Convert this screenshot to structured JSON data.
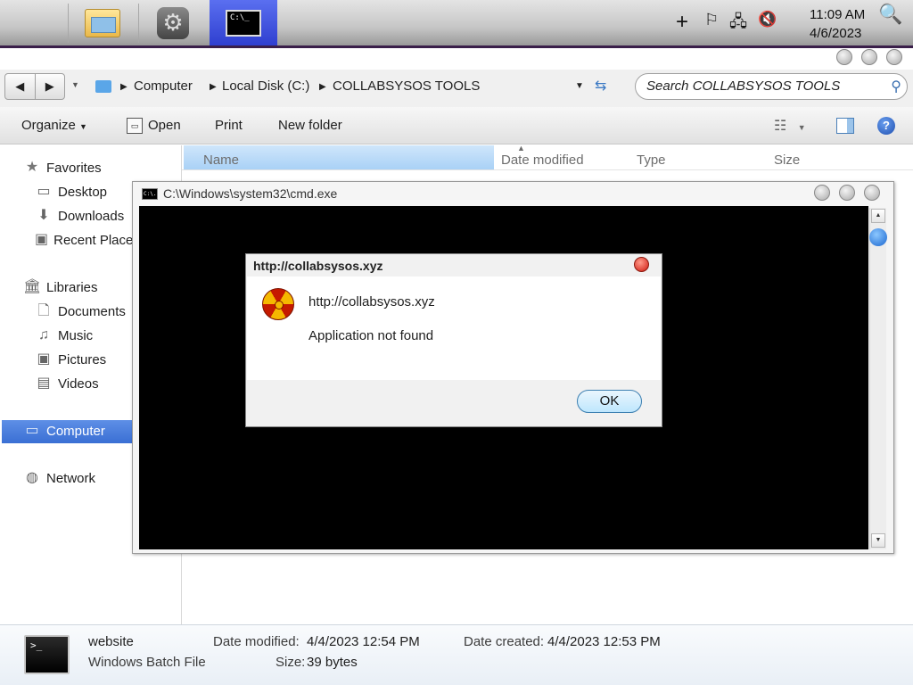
{
  "taskbar": {
    "cmd_icon_text": "C:\\_",
    "clock_time": "11:09 AM",
    "clock_date": "4/6/2023"
  },
  "explorer": {
    "breadcrumb": [
      "Computer",
      "Local Disk (C:)",
      "COLLABSYSOS TOOLS"
    ],
    "search_placeholder": "Search COLLABSYSOS TOOLS",
    "toolbar": {
      "organize": "Organize",
      "open": "Open",
      "print": "Print",
      "new_folder": "New folder"
    },
    "nav": {
      "favorites": "Favorites",
      "desktop": "Desktop",
      "downloads": "Downloads",
      "recent_places": "Recent Places",
      "libraries": "Libraries",
      "documents": "Documents",
      "music": "Music",
      "pictures": "Pictures",
      "videos": "Videos",
      "computer": "Computer",
      "network": "Network"
    },
    "columns": {
      "name": "Name",
      "date_modified": "Date modified",
      "type": "Type",
      "size": "Size"
    }
  },
  "cmd_window": {
    "title": "C:\\Windows\\system32\\cmd.exe",
    "icon_text": "C:\\."
  },
  "dialog": {
    "title": "http://collabsysos.xyz",
    "message_url": "http://collabsysos.xyz",
    "message_text": "Application not found",
    "ok_label": "OK"
  },
  "details": {
    "file_name": "website",
    "file_type": "Windows Batch File",
    "date_modified_label": "Date modified:",
    "date_modified_value": "4/4/2023 12:54 PM",
    "size_label": "Size:",
    "size_value": "39 bytes",
    "date_created_label": "Date created:",
    "date_created_value": "4/4/2023 12:53 PM",
    "icon_text": ">_"
  }
}
